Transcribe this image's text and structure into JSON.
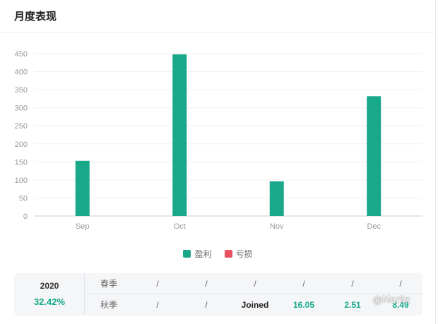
{
  "header": {
    "title": "月度表现"
  },
  "chart_data": {
    "type": "bar",
    "categories": [
      "Sep",
      "Oct",
      "Nov",
      "Dec"
    ],
    "series": [
      {
        "name": "盈利",
        "values": [
          153,
          448,
          96,
          332
        ],
        "color": "#19a88a"
      },
      {
        "name": "亏损",
        "values": [
          0,
          0,
          0,
          0
        ],
        "color": "#e8525f"
      }
    ],
    "yticks": [
      0,
      50,
      100,
      150,
      200,
      250,
      300,
      350,
      400,
      450
    ],
    "ylim": [
      0,
      450
    ],
    "grid": true,
    "legend_position": "bottom"
  },
  "legend": [
    {
      "label": "盈利",
      "color": "#19a88a"
    },
    {
      "label": "亏损",
      "color": "#e8525f"
    }
  ],
  "stats": {
    "year": "2020",
    "percent": "32.42%",
    "rows": [
      {
        "season": "春季",
        "values": [
          "/",
          "/",
          "/",
          "/",
          "/",
          "/"
        ]
      },
      {
        "season": "秋季",
        "values": [
          "/",
          "/",
          "Joined",
          "16.05",
          "2.51",
          "8.49"
        ]
      }
    ]
  },
  "watermark": {
    "text": "@Merlin"
  }
}
